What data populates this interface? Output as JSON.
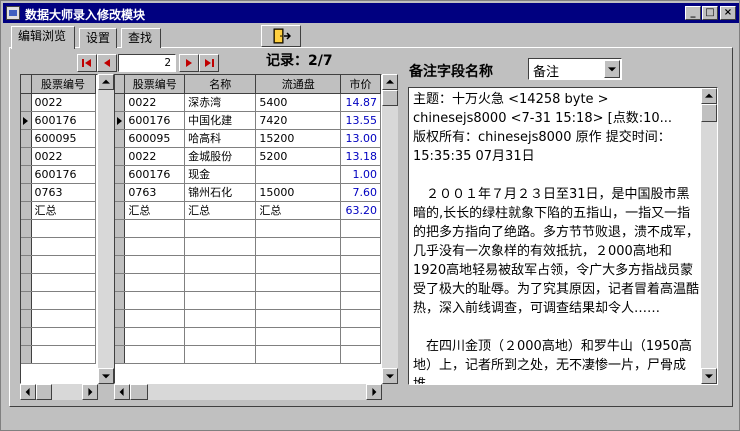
{
  "window": {
    "title": "数据大师录入修改模块"
  },
  "title_buttons": {
    "minimize": "_",
    "maximize": "□",
    "close": "×"
  },
  "tabs": [
    {
      "label": "编辑浏览",
      "active": true
    },
    {
      "label": "设置",
      "active": false
    },
    {
      "label": "查找",
      "active": false
    }
  ],
  "navigator": {
    "current": "2",
    "record_label": "记录：2/7"
  },
  "left_grid": {
    "header": "股票编号",
    "rows": [
      "0022",
      "600176",
      "600095",
      "0022",
      "600176",
      "0763",
      "汇总"
    ],
    "current_row": 1
  },
  "main_grid": {
    "headers": [
      "股票编号",
      "名称",
      "流通盘",
      "市价"
    ],
    "rows": [
      [
        "0022",
        "深赤湾",
        "5400",
        "14.87"
      ],
      [
        "600176",
        "中国化建",
        "7420",
        "13.55"
      ],
      [
        "600095",
        "哈高科",
        "15200",
        "13.00"
      ],
      [
        "0022",
        "金城股份",
        "5200",
        "13.18"
      ],
      [
        "600176",
        "现金",
        "",
        "1.00"
      ],
      [
        "0763",
        "锦州石化",
        "15000",
        "7.60"
      ],
      [
        "汇总",
        "汇总",
        "汇总",
        "63.20"
      ]
    ],
    "current_row": 1
  },
  "memo": {
    "label": "备注字段名称",
    "field_value": "备注",
    "paragraphs": [
      "主题：十万火急 <14258 byte > chinesejs8000 <7-31 15:18> [点数:10...",
      "版权所有：chinesejs8000 原作  提交时间：15:35:35 07月31日",
      "　２００１年７月２３日至31日，是中国股市黑暗的,长长的绿柱就象下陷的五指山，一指又一指的把多方指向了绝路。多方节节败退，溃不成军，几乎没有一次象样的有效抵抗，２000高地和1920高地轻易被敌军占领，令广大多方指战员蒙受了极大的耻辱。为了究其原因，记者冒着高温酷热，深入前线调查，可调查结果却令人……",
      "　在四川金顶（２000高地）和罗牛山（1950高地）上，记者所到之处，无不凄惨一片，尸骨成堆。"
    ]
  },
  "icons": {
    "exit": "exit-door-icon",
    "first": "first-record-icon",
    "prior": "prior-record-icon",
    "next": "next-record-icon",
    "last": "last-record-icon"
  },
  "colors": {
    "titlebar": "#000080",
    "price_text": "#0000c0",
    "nav_arrows": "#c00000"
  }
}
